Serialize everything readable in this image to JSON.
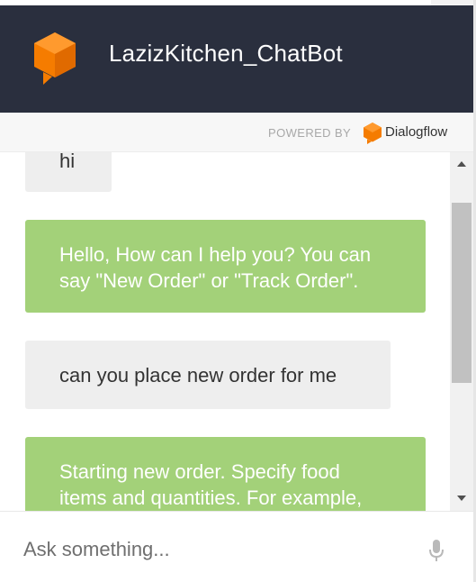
{
  "header": {
    "title": "LazizKitchen_ChatBot"
  },
  "powered_by": {
    "label": "POWERED BY",
    "brand": "Dialogflow"
  },
  "messages": [
    {
      "sender": "user",
      "text": "hi"
    },
    {
      "sender": "bot",
      "text": "Hello, How can I help you? You can say \"New Order\" or \"Track Order\"."
    },
    {
      "sender": "user",
      "text": "can you place new order for me"
    },
    {
      "sender": "bot",
      "text": "Starting new order. Specify food items and quantities. For example,"
    }
  ],
  "input": {
    "placeholder": "Ask something..."
  },
  "icons": {
    "logo": "chatbot-cube-icon",
    "brand": "dialogflow-icon",
    "mic": "microphone-icon",
    "scroll_up": "scroll-up-arrow-icon",
    "scroll_down": "scroll-down-arrow-icon"
  },
  "colors": {
    "header_bg": "#2a2f3e",
    "accent_orange": "#f57c00",
    "bot_bubble": "#a3d179",
    "user_bubble": "#eeeeee"
  }
}
